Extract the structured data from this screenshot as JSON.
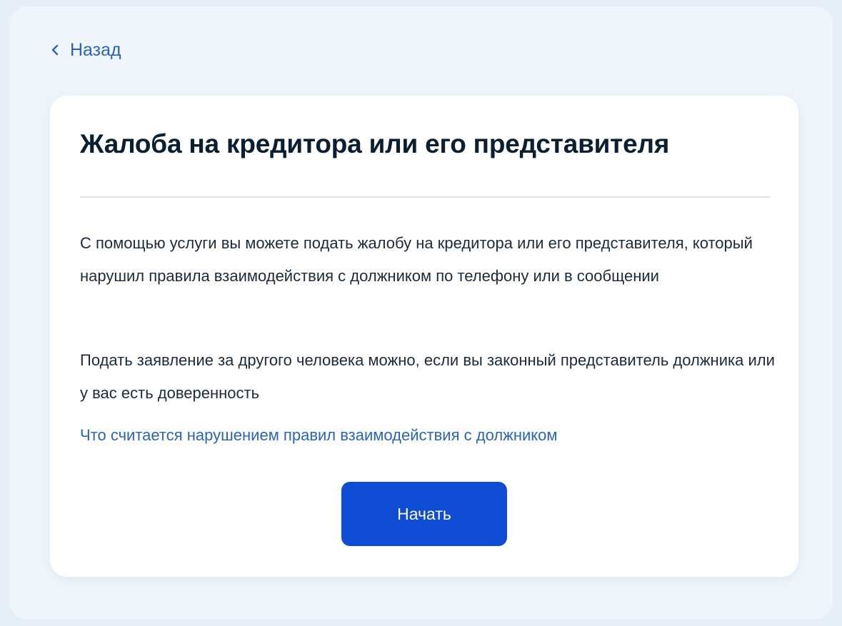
{
  "navigation": {
    "back_label": "Назад"
  },
  "card": {
    "title": "Жалоба на кредитора или его представителя",
    "paragraphs": [
      "С помощью услуги вы можете подать жалобу на кредитора или его представителя, который нарушил правила взаимодействия с должником по телефону или в сообщении",
      "Подать заявление за другого человека можно, если вы законный представитель должника или у вас есть доверенность"
    ],
    "info_link": "Что считается нарушением правил взаимодействия с должником",
    "start_button": "Начать"
  },
  "icons": {
    "back": "chevron-left-icon"
  },
  "colors": {
    "accent": "#0d4cd3",
    "link": "#2a64b8",
    "text": "#1c2b3a",
    "title": "#0b1f33",
    "background": "#e6eef7"
  }
}
